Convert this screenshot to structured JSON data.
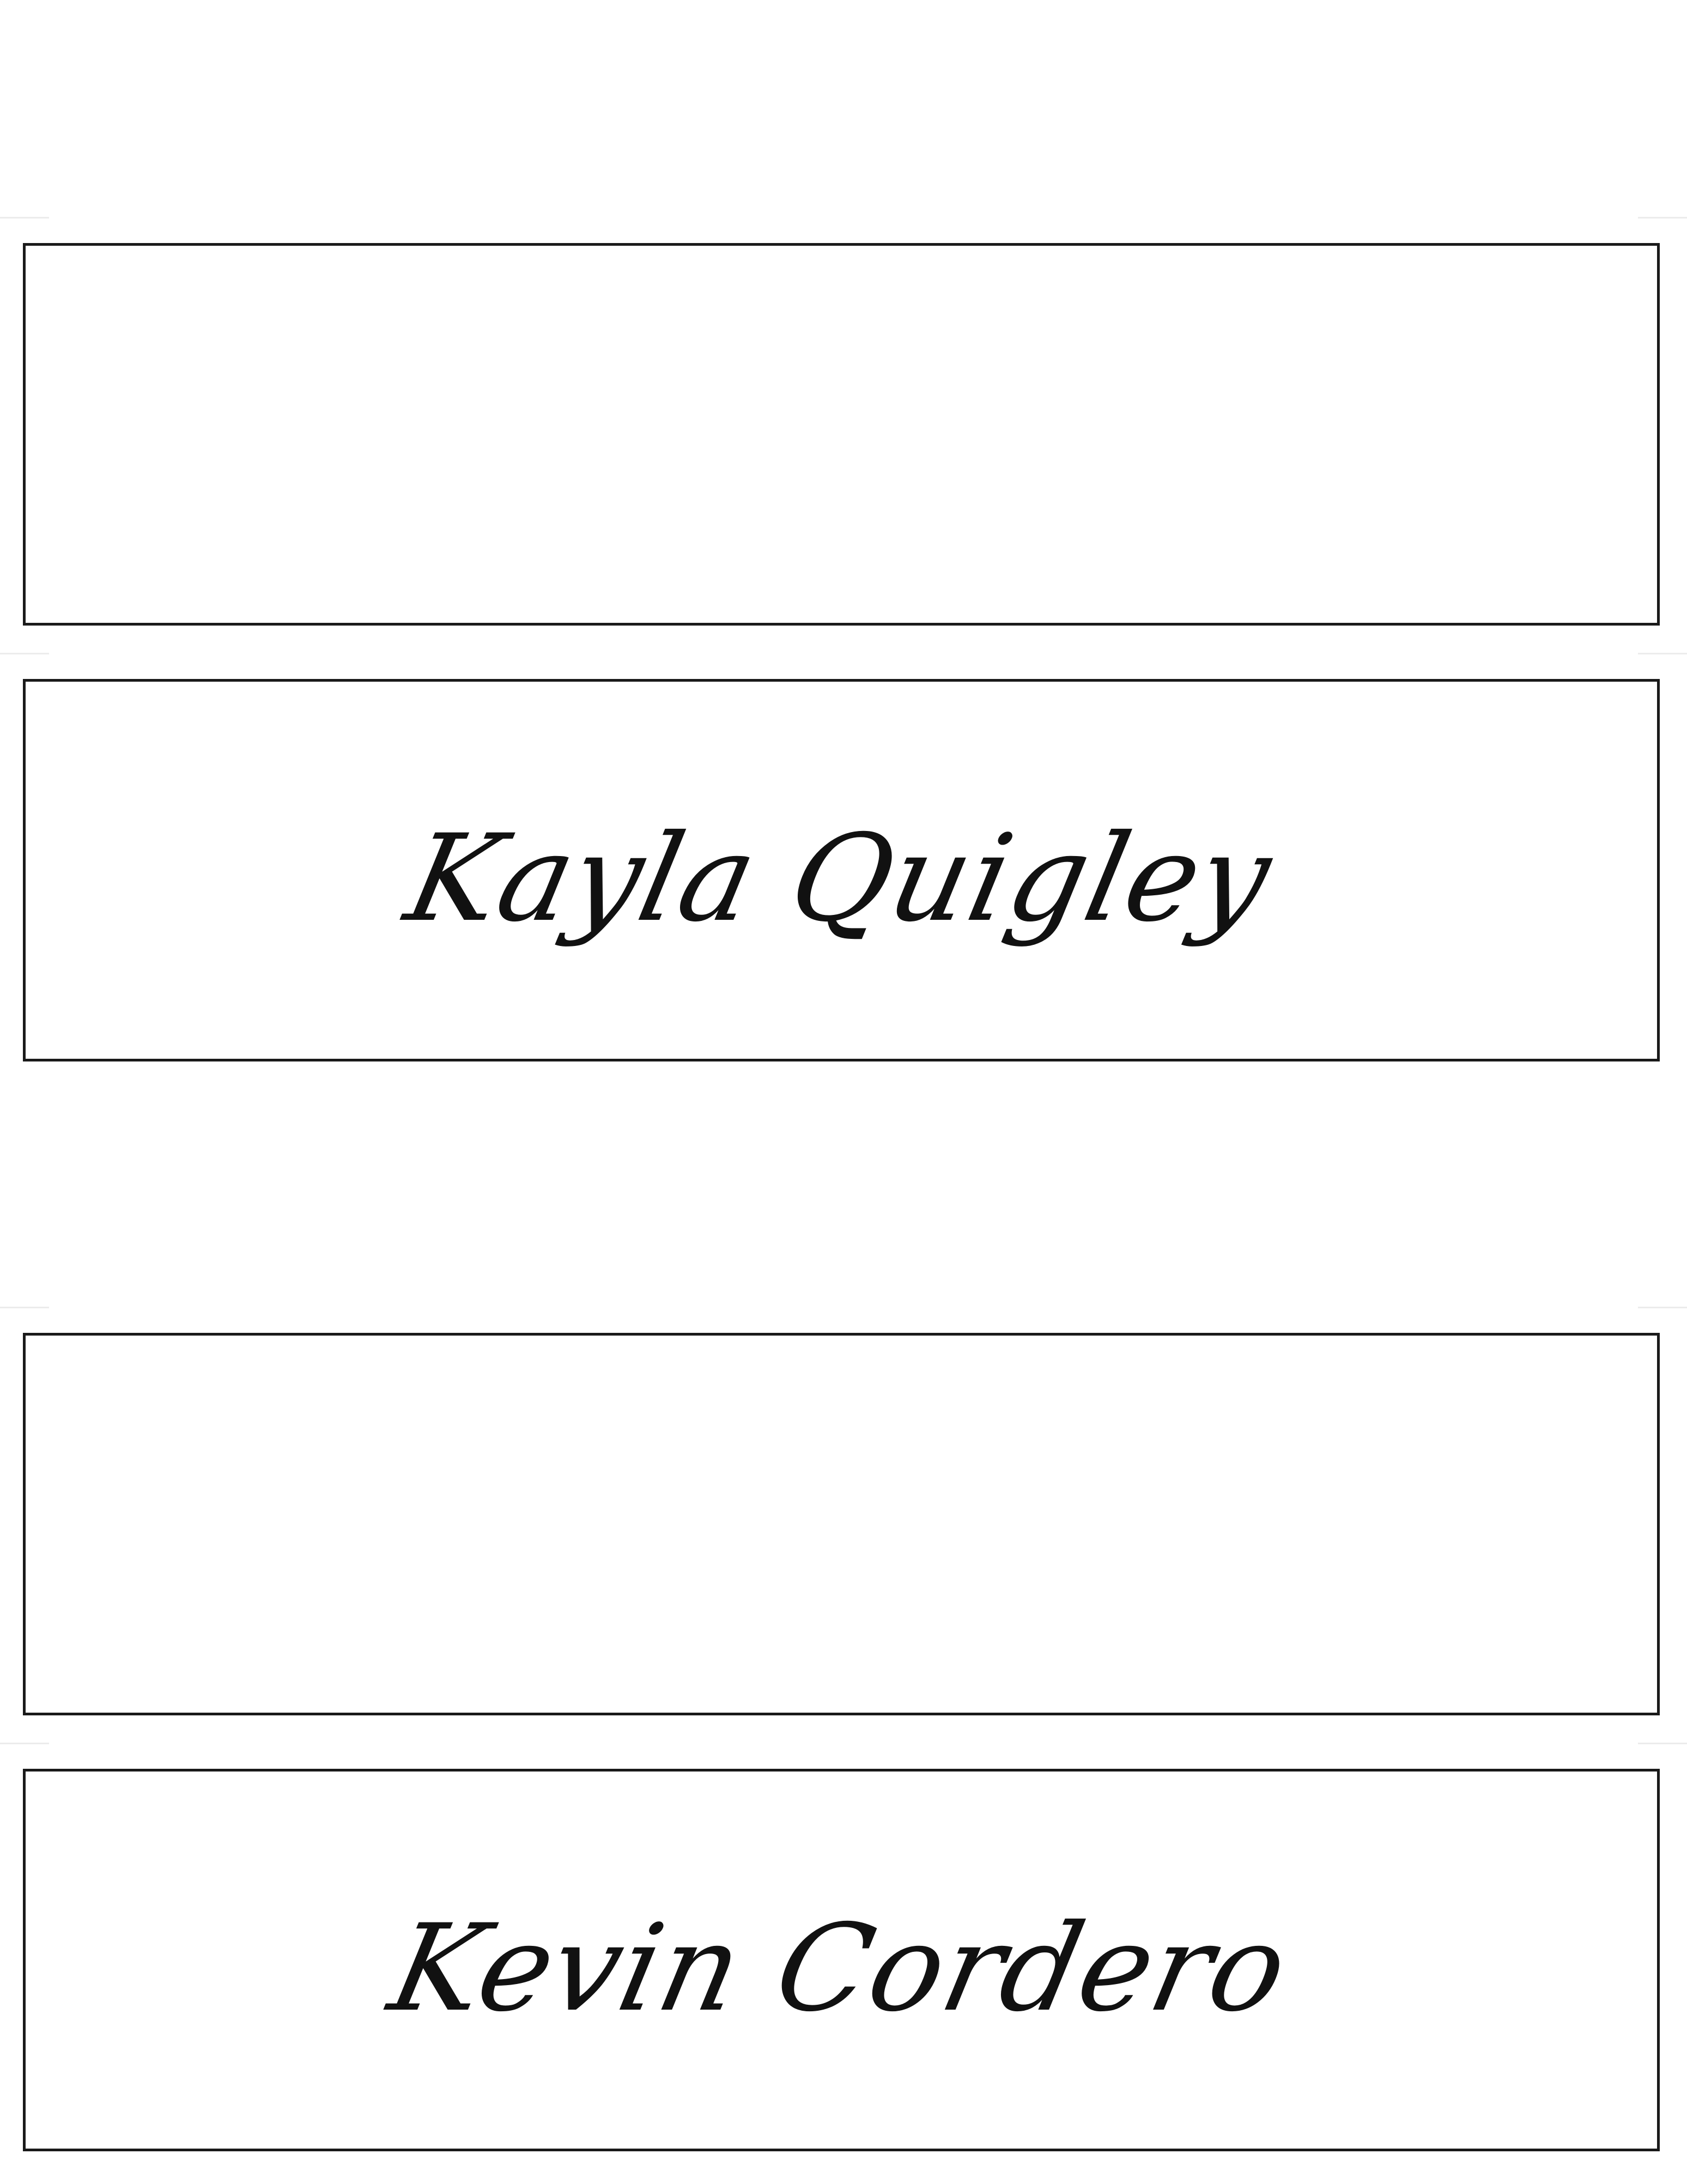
{
  "place_cards": [
    {
      "name": ""
    },
    {
      "name": "Kayla Quigley"
    },
    {
      "name": ""
    },
    {
      "name": "Kevin Cordero"
    }
  ]
}
